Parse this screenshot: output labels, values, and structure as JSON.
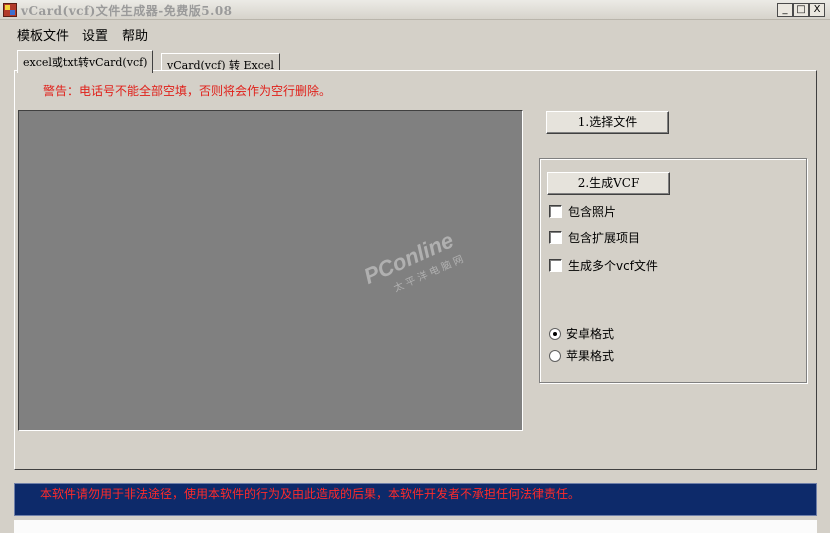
{
  "window": {
    "title": "vCard(vcf)文件生成器-免费版5.08",
    "min_label": "_",
    "max_label": "□",
    "close_label": "X"
  },
  "menu": [
    "模板文件",
    "设置",
    "帮助"
  ],
  "tabs": [
    {
      "label": "excel或txt转vCard(vcf)",
      "active": true
    },
    {
      "label": "vCard(vcf) 转 Excel",
      "active": false
    }
  ],
  "panel": {
    "warning": "警告：电话号不能全部空填，否则将会作为空行删除。",
    "select_file_button": "1.选择文件",
    "generate_button": "2.生成VCF",
    "options": [
      {
        "label": "包含照片",
        "checked": false
      },
      {
        "label": "包含扩展项目",
        "checked": false
      },
      {
        "label": "生成多个vcf文件",
        "checked": false
      }
    ],
    "formats": [
      {
        "label": "安卓格式",
        "selected": true
      },
      {
        "label": "苹果格式",
        "selected": false
      }
    ],
    "watermark": {
      "logo": "PConline",
      "sub": "太平洋电脑网"
    }
  },
  "footer": {
    "notice": "本软件请勿用于非法途径，使用本软件的行为及由此造成的后果，本软件开发者不承担任何法律责任。"
  },
  "colors": {
    "warning_text": "#e0201a",
    "footer_bg": "#0d2a6a",
    "footer_text": "#ff2a2a",
    "preview_bg": "#808080",
    "window_bg": "#d4d0c8"
  }
}
